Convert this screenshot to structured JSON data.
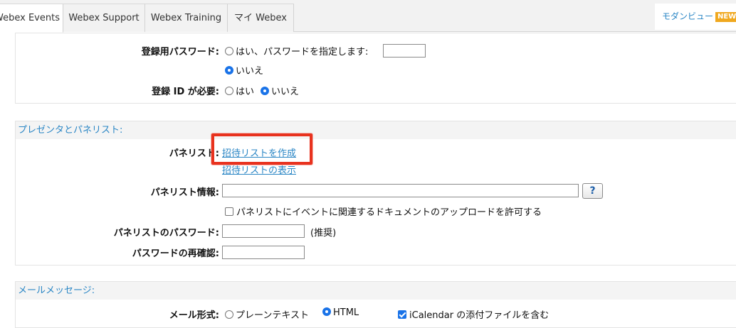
{
  "tabs": [
    {
      "label": "Webex Events",
      "active": true
    },
    {
      "label": "Webex Support",
      "active": false
    },
    {
      "label": "Webex Training",
      "active": false
    },
    {
      "label": "マイ Webex",
      "active": false
    }
  ],
  "modern_view": {
    "label": "モダンビュー",
    "badge": "NEW"
  },
  "registration": {
    "password_label": "登録用パスワード:",
    "password_yes": "はい、パスワードを指定します:",
    "password_yes_selected": false,
    "password_value": "",
    "password_no": "いいえ",
    "password_no_selected": true,
    "id_label": "登録 ID が必要:",
    "id_yes": "はい",
    "id_yes_selected": false,
    "id_no": "いいえ",
    "id_no_selected": true
  },
  "presenters": {
    "heading": "プレゼンタとパネリスト:",
    "panelists_label": "パネリスト:",
    "create_invite_link": "招待リストを作成",
    "show_invite_link": "招待リストの表示",
    "panelist_info_label": "パネリスト情報:",
    "panelist_info_value": "",
    "help_label": "?",
    "upload_checkbox_label": "パネリストにイベントに関連するドキュメントのアップロードを許可する",
    "upload_checked": false,
    "panelist_password_label": "パネリストのパスワード:",
    "panelist_password_value": "",
    "recommended": "(推奨)",
    "confirm_password_label": "パスワードの再確認:",
    "confirm_password_value": ""
  },
  "email": {
    "heading": "メールメッセージ:",
    "format_label": "メール形式:",
    "plain_text": "プレーンテキスト",
    "plain_selected": false,
    "html": "HTML",
    "html_selected": true,
    "icalendar_label": "iCalendar の添付ファイルを含む",
    "icalendar_checked": true
  },
  "colors": {
    "accent": "#2a86c5",
    "highlight": "#e8321e",
    "badge": "#f0a81e"
  }
}
